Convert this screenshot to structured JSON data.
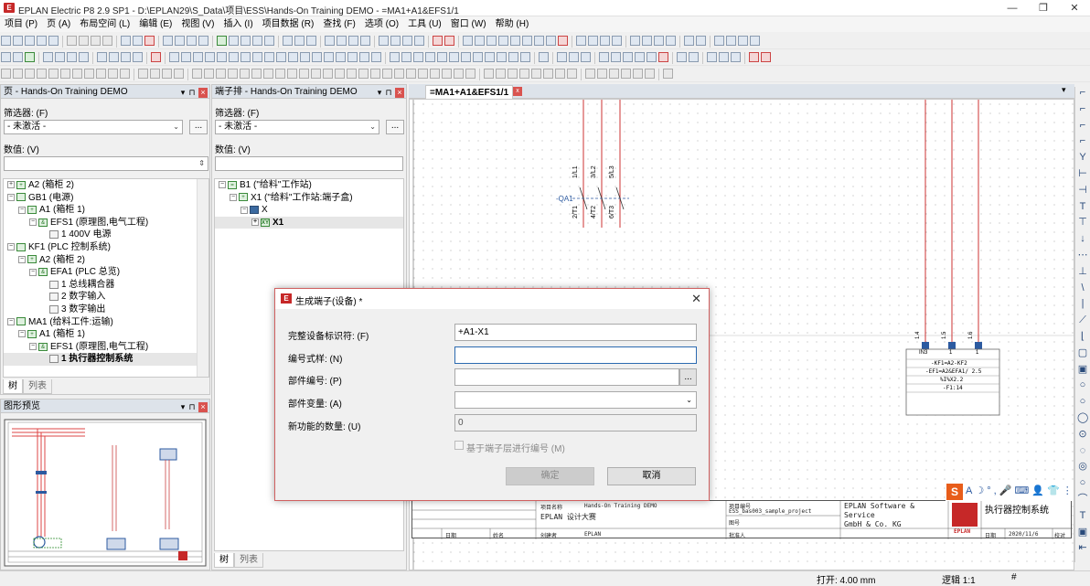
{
  "window": {
    "app_icon": "eplan-icon",
    "title": "EPLAN Electric P8 2.9 SP1 - D:\\EPLAN29\\S_Data\\项目\\ESS\\Hands-On Training DEMO - =MA1+A1&EFS1/1",
    "minimize": "—",
    "restore": "❐",
    "close": "✕"
  },
  "menu": [
    "项目 (P)",
    "页 (A)",
    "布局空间 (L)",
    "编辑 (E)",
    "视图 (V)",
    "插入 (I)",
    "项目数据 (R)",
    "查找 (F)",
    "选项 (O)",
    "工具 (U)",
    "窗口 (W)",
    "帮助 (H)"
  ],
  "page_nav": {
    "header": "页 - Hands-On Training DEMO",
    "filter_label": "筛选器: (F)",
    "filter_value": "- 未激活 -",
    "filter_btn": "...",
    "value_label": "数值: (V)",
    "tree": [
      {
        "label": "A2 (箱柜 2)",
        "exp": "+",
        "icon": "gn",
        "mark": "+",
        "indent": 1
      },
      {
        "label": "GB1 (电源)",
        "exp": "-",
        "icon": "gn",
        "mark": "",
        "indent": 1
      },
      {
        "label": "A1 (箱柜 1)",
        "exp": "-",
        "icon": "gn",
        "mark": "+",
        "indent": 2
      },
      {
        "label": "EFS1 (原理图,电气工程)",
        "exp": "-",
        "icon": "gn",
        "mark": "&",
        "indent": 3
      },
      {
        "label": "1 400V 电源",
        "exp": "",
        "icon": "pg",
        "mark": "",
        "indent": 4
      },
      {
        "label": "KF1 (PLC 控制系统)",
        "exp": "-",
        "icon": "gn",
        "mark": "",
        "indent": 1
      },
      {
        "label": "A2 (箱柜 2)",
        "exp": "-",
        "icon": "gn",
        "mark": "+",
        "indent": 2
      },
      {
        "label": "EFA1 (PLC 总览)",
        "exp": "-",
        "icon": "gn",
        "mark": "&",
        "indent": 3
      },
      {
        "label": "1 总线耦合器",
        "exp": "",
        "icon": "pg",
        "mark": "",
        "indent": 4
      },
      {
        "label": "2 数字输入",
        "exp": "",
        "icon": "pg",
        "mark": "",
        "indent": 4
      },
      {
        "label": "3 数字输出",
        "exp": "",
        "icon": "pg",
        "mark": "",
        "indent": 4
      },
      {
        "label": "MA1 (给料工件:运输)",
        "exp": "-",
        "icon": "gn",
        "mark": "",
        "indent": 1
      },
      {
        "label": "A1 (箱柜 1)",
        "exp": "-",
        "icon": "gn",
        "mark": "+",
        "indent": 2
      },
      {
        "label": "EFS1 (原理图,电气工程)",
        "exp": "-",
        "icon": "gn",
        "mark": "&",
        "indent": 3
      },
      {
        "label": "1 执行器控制系统",
        "exp": "",
        "icon": "pg",
        "mark": "",
        "indent": 4,
        "selected": true
      }
    ],
    "tabs": [
      "树",
      "列表"
    ]
  },
  "preview": {
    "header": "图形预览"
  },
  "terminal_nav": {
    "header": "端子排 - Hands-On Training DEMO",
    "filter_label": "筛选器: (F)",
    "filter_value": "- 未激活 -",
    "filter_btn": "...",
    "value_label": "数值: (V)",
    "tree": [
      {
        "label": "B1 (\"给料\"工作站)",
        "exp": "-",
        "icon": "gn",
        "mark": "=",
        "indent": 1
      },
      {
        "label": "X1 (\"给料\"工作站:端子盒)",
        "exp": "-",
        "icon": "gn",
        "mark": "+",
        "indent": 2
      },
      {
        "label": "X",
        "exp": "-",
        "icon": "dv",
        "mark": "",
        "indent": 3
      },
      {
        "label": "X1",
        "exp": "+",
        "icon": "gn",
        "mark": "XY",
        "indent": 4,
        "selected": true
      }
    ],
    "tabs": [
      "树",
      "列表"
    ]
  },
  "document_tab": {
    "label": "=MA1+A1&EFS1/1",
    "close": "x"
  },
  "schematic": {
    "device": "-QA1",
    "terms_top": [
      "1/L1",
      "3/L2",
      "5/L3"
    ],
    "terms_bottom": [
      "2/T1",
      "4/T2",
      "6/T3"
    ],
    "col_labels": [
      "1.4",
      "1.5",
      "1.6"
    ],
    "plc_labels": [
      "-KF1=A2-KF2",
      "-EF1=A2&EFA1/ 2.5",
      "%I%X2.2",
      "-F1:14"
    ],
    "pin_labels": [
      "IN3",
      "1",
      "1"
    ]
  },
  "title_block": {
    "project_name_label": "项目名称",
    "project_name": "Hands-On Training DEMO",
    "project_sub": "EPLAN 设计大赛",
    "project_no_label": "项目编号",
    "project_no": "ESS_bas003_sample_project",
    "drawing_no_label": "图号",
    "company": [
      "EPLAN Software &",
      "Service",
      "GmbH & Co. KG"
    ],
    "page_title": "执行器控制系统",
    "date_label": "日期",
    "name_label": "姓名",
    "creator_label": "创建者",
    "creator": "EPLAN",
    "approver_label": "批准人",
    "date_label2": "日期",
    "date_value": "2020/11/6",
    "check_label": "校对",
    "logo": "EPLAN"
  },
  "dialog": {
    "icon": "eplan-icon",
    "title": "生成端子(设备) *",
    "fields": [
      {
        "label": "完整设备标识符: (F)",
        "value": "+A1-X1"
      },
      {
        "label": "编号式样: (N)",
        "value": ""
      },
      {
        "label": "部件编号: (P)",
        "value": ""
      },
      {
        "label": "部件变量: (A)",
        "value": ""
      },
      {
        "label": "新功能的数量: (U)",
        "value": "0"
      }
    ],
    "part_btn": "...",
    "checkbox_label": "基于端子层进行编号 (M)",
    "ok": "确定",
    "cancel": "取消"
  },
  "ime": {
    "label": "S",
    "items": [
      "A",
      "☽",
      "°,",
      "🎤",
      "⌨",
      "👤",
      "👕",
      "⋮"
    ]
  },
  "statusbar": {
    "open": "打开: 4.00 mm",
    "logic": "逻辑 1:1",
    "hash": "#"
  }
}
